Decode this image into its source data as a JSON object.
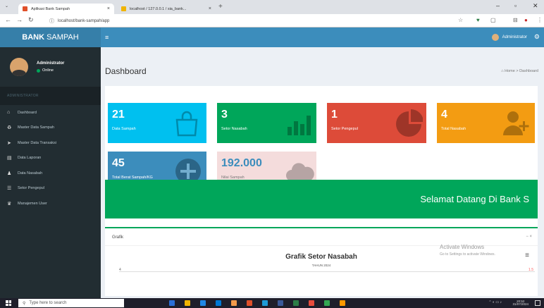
{
  "browser": {
    "tabs": [
      {
        "title": "Aplikasi Bank Sampah",
        "color": "#e0502a"
      },
      {
        "title": "localhost / 127.0.0.1 / sia_bank...",
        "color": "#f0b400"
      }
    ],
    "new_tab": "+",
    "url": "localhost/bank-sampah/app"
  },
  "app": {
    "brand_bold": "BANK",
    "brand_rest": "SAMPAH",
    "user_name": "Administrator"
  },
  "sidebar": {
    "user_name": "Administrator",
    "status": "Online",
    "section": "ADMINISTRATOR",
    "items": [
      {
        "label": "Dashboard",
        "icon": "home-icon",
        "glyph": "⌂"
      },
      {
        "label": "Master Data Sampah",
        "icon": "recycle-icon",
        "glyph": "♻"
      },
      {
        "label": "Master Data Transaksi",
        "icon": "send-icon",
        "glyph": "➤"
      },
      {
        "label": "Data Laporan",
        "icon": "chart-icon",
        "glyph": "▤"
      },
      {
        "label": "Data Nasabah",
        "icon": "user-icon",
        "glyph": "♟"
      },
      {
        "label": "Setor Pengepul",
        "icon": "list-icon",
        "glyph": "☰"
      },
      {
        "label": "Manajemen User",
        "icon": "users-icon",
        "glyph": "♛"
      }
    ]
  },
  "content": {
    "title": "Dashboard",
    "breadcrumb_home": "Home",
    "breadcrumb_current": "Dashboard"
  },
  "stats": [
    {
      "value": "21",
      "label": "Data Sampah",
      "color": "#00c0ef",
      "icon": "shopping-bag-icon"
    },
    {
      "value": "3",
      "label": "Setor Nasabah",
      "color": "#00a65a",
      "icon": "bar-chart-icon"
    },
    {
      "value": "1",
      "label": "Setor Pengepul",
      "color": "#dd4b39",
      "icon": "pie-chart-icon"
    },
    {
      "value": "4",
      "label": "Total Nasabah",
      "color": "#f39c12",
      "icon": "user-add-icon"
    },
    {
      "value": "45",
      "label": "Total Berat Sampah/KG",
      "color": "#3c8dbc",
      "icon": "plus-circle-icon"
    },
    {
      "value": "192.000",
      "label": "Nilai Sampah",
      "color": "#f4dcdc",
      "icon": "cloud-icon"
    }
  ],
  "welcome": "Selamat Datang Di Bank S",
  "graph": {
    "title": "Grafik",
    "tools": "−  ×",
    "menu": "≡"
  },
  "chart_data": {
    "type": "line",
    "title": "Grafik Setor Nasabah",
    "subtitle": "TAHUN 2024",
    "yticks_left": [
      "4"
    ],
    "yticks_right": [
      "1.5"
    ]
  },
  "watermark": {
    "line1": "Activate Windows",
    "line2": "Go to Settings to activate Windows."
  },
  "taskbar": {
    "search_placeholder": "Type here to search",
    "time": "20:52",
    "date": "31/07/2024",
    "icons": [
      "#2b6fd6",
      "#f0b400",
      "#1e88e5",
      "#0078d4",
      "#f2994a",
      "#e0502a",
      "#1f9bd7",
      "#3b5998",
      "#2d7d46",
      "#e84c3d",
      "#34a853",
      "#ff9800"
    ]
  }
}
